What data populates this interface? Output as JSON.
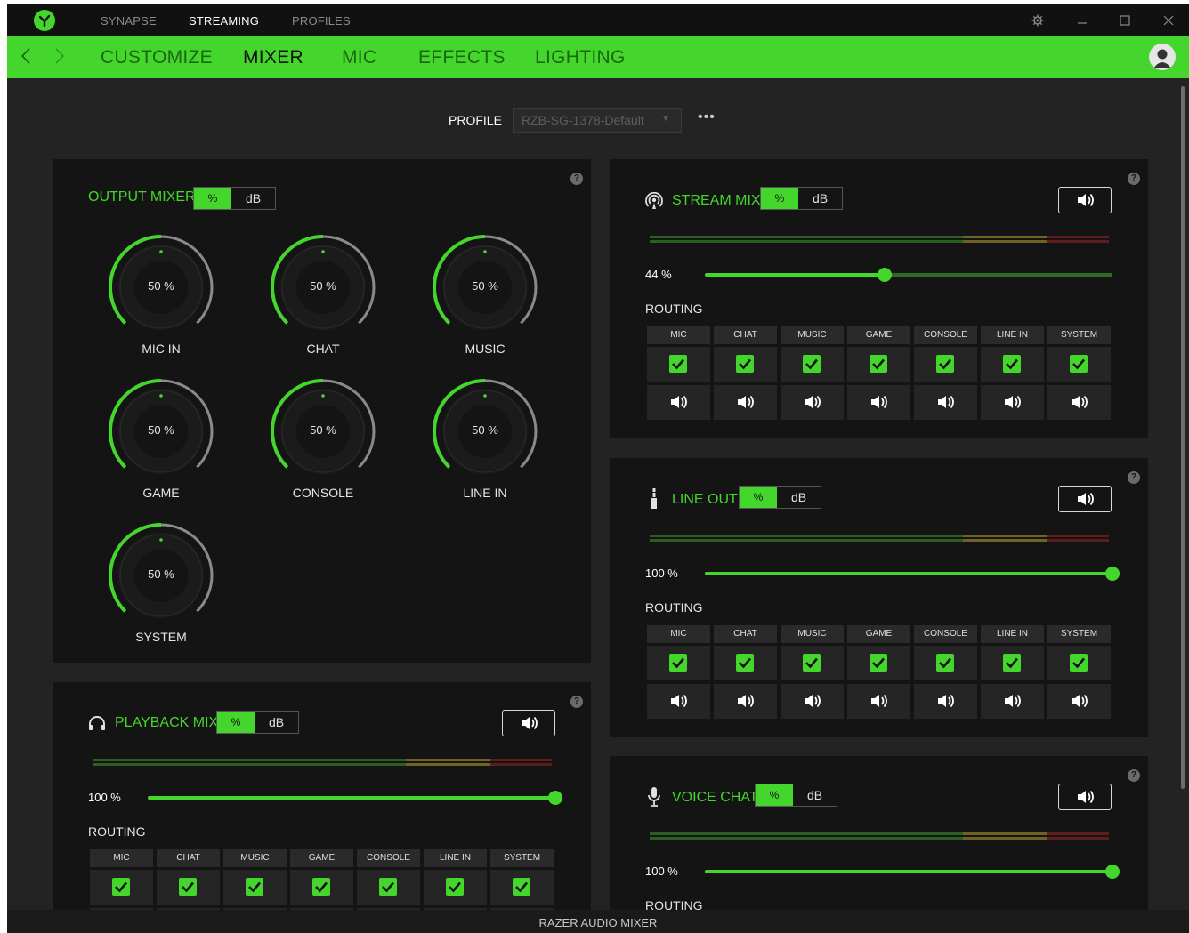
{
  "titlebar": {
    "tabs": [
      "SYNAPSE",
      "STREAMING",
      "PROFILES"
    ],
    "active_tab": "STREAMING"
  },
  "nav": {
    "tabs": [
      "CUSTOMIZE",
      "MIXER",
      "MIC",
      "EFFECTS",
      "LIGHTING"
    ],
    "active_tab": "MIXER"
  },
  "profile": {
    "label": "PROFILE",
    "value": "RZB-SG-1378-Default",
    "more": "•••"
  },
  "units": {
    "percent": "%",
    "db": "dB"
  },
  "output_mixer": {
    "title": "OUTPUT MIXER",
    "help": "?",
    "channels": [
      {
        "label": "MIC IN",
        "value": "50 %",
        "level": 0.5
      },
      {
        "label": "CHAT",
        "value": "50 %",
        "level": 0.5
      },
      {
        "label": "MUSIC",
        "value": "50 %",
        "level": 0.5
      },
      {
        "label": "GAME",
        "value": "50 %",
        "level": 0.5
      },
      {
        "label": "CONSOLE",
        "value": "50 %",
        "level": 0.5
      },
      {
        "label": "LINE IN",
        "value": "50 %",
        "level": 0.5
      },
      {
        "label": "SYSTEM",
        "value": "50 %",
        "level": 0.5
      }
    ]
  },
  "routing_columns": [
    "MIC",
    "CHAT",
    "MUSIC",
    "GAME",
    "CONSOLE",
    "LINE IN",
    "SYSTEM"
  ],
  "mixes": {
    "playback": {
      "title": "PLAYBACK MIX",
      "icon": "headphones-icon",
      "volume": "100 %",
      "level": 1.0,
      "routing_label": "ROUTING",
      "help": "?"
    },
    "stream": {
      "title": "STREAM MIX",
      "icon": "broadcast-icon",
      "volume": "44 %",
      "level": 0.44,
      "routing_label": "ROUTING",
      "help": "?"
    },
    "line_out": {
      "title": "LINE OUT",
      "icon": "audio-jack-icon",
      "volume": "100 %",
      "level": 1.0,
      "routing_label": "ROUTING",
      "help": "?"
    },
    "voice_chat": {
      "title": "VOICE CHAT",
      "icon": "microphone-icon",
      "volume": "100 %",
      "level": 1.0,
      "routing_label": "ROUTING",
      "help": "?"
    }
  },
  "footer": {
    "title": "RAZER AUDIO MIXER"
  },
  "colors": {
    "accent": "#44d62c",
    "background": "#232323",
    "panel": "#141414",
    "meter_yellow": "#8a7a28",
    "meter_red": "#7a2222"
  }
}
